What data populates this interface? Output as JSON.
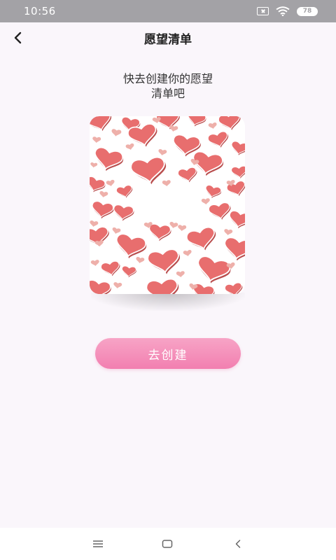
{
  "status_bar": {
    "time": "10:56",
    "battery": "78",
    "icons": [
      "notification-box-icon",
      "wifi-icon",
      "battery-icon"
    ]
  },
  "header": {
    "title": "愿望清单",
    "back_icon": "chevron-left-icon"
  },
  "empty_state": {
    "prompt_line1": "快去创建你的愿望",
    "prompt_line2": "清单吧",
    "illustration": "hearts-pattern",
    "heart_color": "#e86e6e",
    "heart_light_color": "#eeb0aa"
  },
  "actions": {
    "create_label": "去创建",
    "create_color": "#f27fb0"
  },
  "nav_bar": {
    "icons": [
      "menu-icon",
      "home-icon",
      "back-icon"
    ]
  }
}
